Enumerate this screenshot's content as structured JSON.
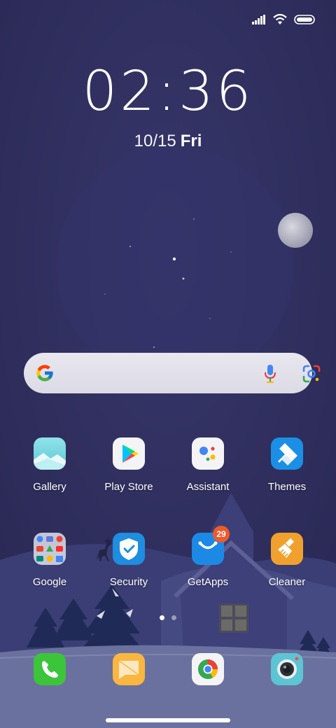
{
  "status_bar": {
    "icons": [
      "cellular-signal-icon",
      "wifi-icon",
      "battery-icon"
    ]
  },
  "lockclock": {
    "time": "02:36",
    "date": "10/15",
    "weekday": "Fri"
  },
  "search": {
    "icons": [
      "google-logo-icon",
      "microphone-icon",
      "lens-icon"
    ]
  },
  "apps_row1": [
    {
      "label": "Gallery",
      "icon": "gallery-icon"
    },
    {
      "label": "Play Store",
      "icon": "play-store-icon"
    },
    {
      "label": "Assistant",
      "icon": "assistant-icon"
    },
    {
      "label": "Themes",
      "icon": "themes-icon"
    }
  ],
  "apps_row2": [
    {
      "label": "Google",
      "icon": "google-folder-icon"
    },
    {
      "label": "Security",
      "icon": "security-icon"
    },
    {
      "label": "GetApps",
      "icon": "getapps-icon",
      "badge": "29"
    },
    {
      "label": "Cleaner",
      "icon": "cleaner-icon"
    }
  ],
  "page_indicator": {
    "pages": 2,
    "current": 1
  },
  "dock": [
    {
      "icon": "phone-icon"
    },
    {
      "icon": "messaging-icon"
    },
    {
      "icon": "chrome-icon"
    },
    {
      "icon": "camera-icon"
    }
  ],
  "colors": {
    "sky": "#2e2d5a",
    "ground": "#6d73a0",
    "badge": "#ef5a2a"
  }
}
